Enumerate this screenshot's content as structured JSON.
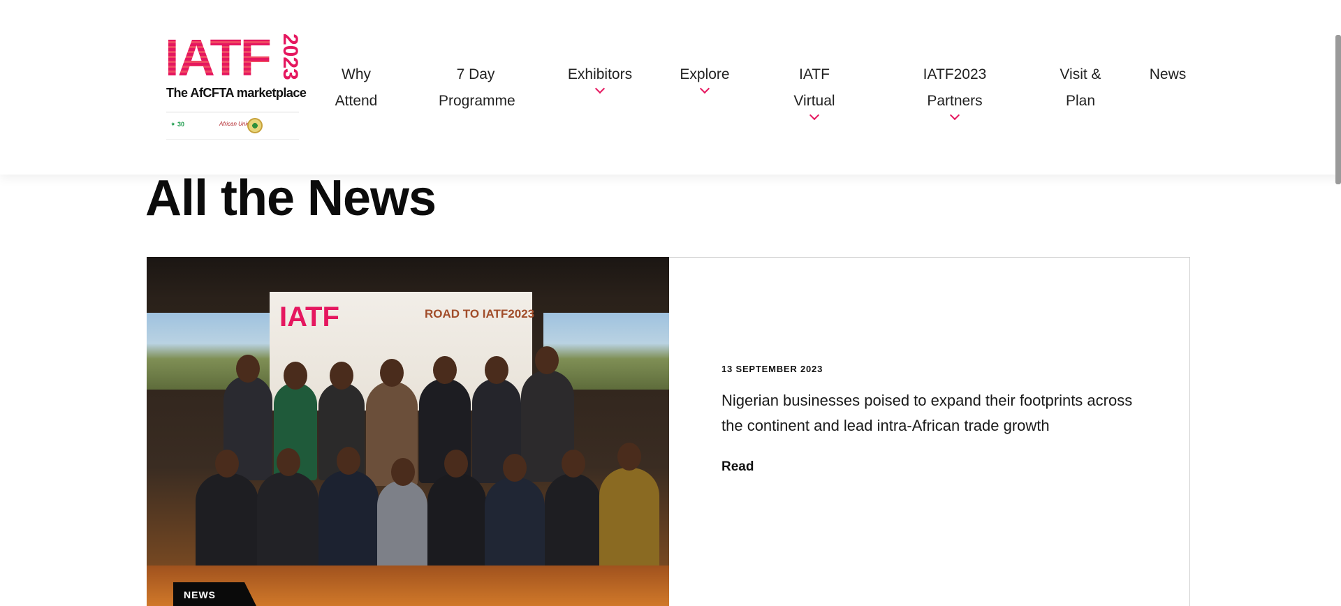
{
  "header": {
    "logo": {
      "wordmark": "IATF",
      "year": "2023",
      "tagline": "The AfCFTA marketplace"
    },
    "nav": [
      {
        "label_line1": "Why",
        "label_line2": "Attend",
        "has_dropdown": false
      },
      {
        "label_line1": "7 Day",
        "label_line2": "Programme",
        "has_dropdown": false
      },
      {
        "label_line1": "Exhibitors",
        "label_line2": "",
        "has_dropdown": true
      },
      {
        "label_line1": "Explore",
        "label_line2": "",
        "has_dropdown": true
      },
      {
        "label_line1": "IATF Virtual",
        "label_line2": "",
        "has_dropdown": true
      },
      {
        "label_line1": "IATF2023 Partners",
        "label_line2": "",
        "has_dropdown": true
      },
      {
        "label_line1": "Visit &",
        "label_line2": "Plan",
        "has_dropdown": false
      },
      {
        "label_line1": "News",
        "label_line2": "",
        "has_dropdown": false
      }
    ]
  },
  "main": {
    "title": "All the News",
    "featured": {
      "photo_banner_wordmark": "IATF",
      "photo_banner_text": "ROAD TO IATF2023",
      "category": "NEWS",
      "date": "13 SEPTEMBER 2023",
      "headline": "Nigerian businesses poised to expand their footprints across the continent and lead intra-African trade growth",
      "read_label": "Read"
    }
  },
  "colors": {
    "accent": "#e5175f",
    "text": "#111111",
    "card_border": "#cfcfcf"
  }
}
